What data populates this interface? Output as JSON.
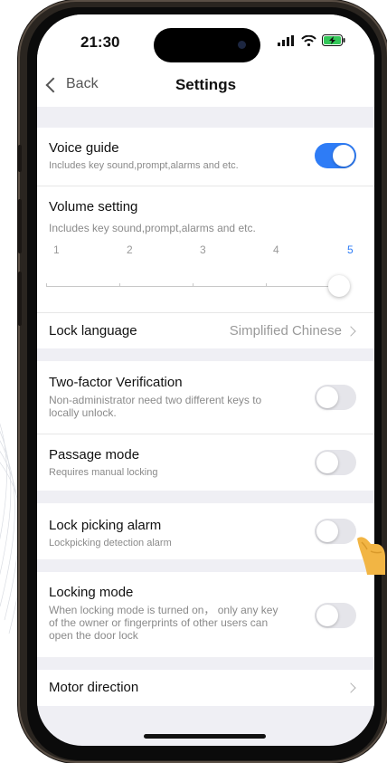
{
  "status_bar": {
    "time": "21:30"
  },
  "nav": {
    "back_label": "Back",
    "title": "Settings"
  },
  "voice_guide": {
    "title": "Voice guide",
    "subtitle": "Includes key sound,prompt,alarms and etc.",
    "enabled": true
  },
  "volume": {
    "title": "Volume setting",
    "subtitle": "Includes key sound,prompt,alarms and etc.",
    "ticks": [
      "1",
      "2",
      "3",
      "4",
      "5"
    ],
    "value": 5
  },
  "lock_language": {
    "title": "Lock language",
    "value": "Simplified Chinese"
  },
  "two_factor": {
    "title": "Two-factor Verification",
    "subtitle": "Non-administrator need two different keys to locally unlock.",
    "enabled": false
  },
  "passage_mode": {
    "title": "Passage mode",
    "subtitle": "Requires manual locking",
    "enabled": false
  },
  "lock_picking": {
    "title": "Lock picking alarm",
    "subtitle": "Lockpicking detection alarm",
    "enabled": false
  },
  "locking_mode": {
    "title": "Locking mode",
    "subtitle": "When locking mode is turned on， only any key of the owner or fingerprints of other users can open the door lock",
    "enabled": false
  },
  "motor_direction": {
    "title": "Motor direction"
  },
  "colors": {
    "accent": "#2e7cf6",
    "toggle_off": "#e5e5ea",
    "background": "#efeff4"
  }
}
